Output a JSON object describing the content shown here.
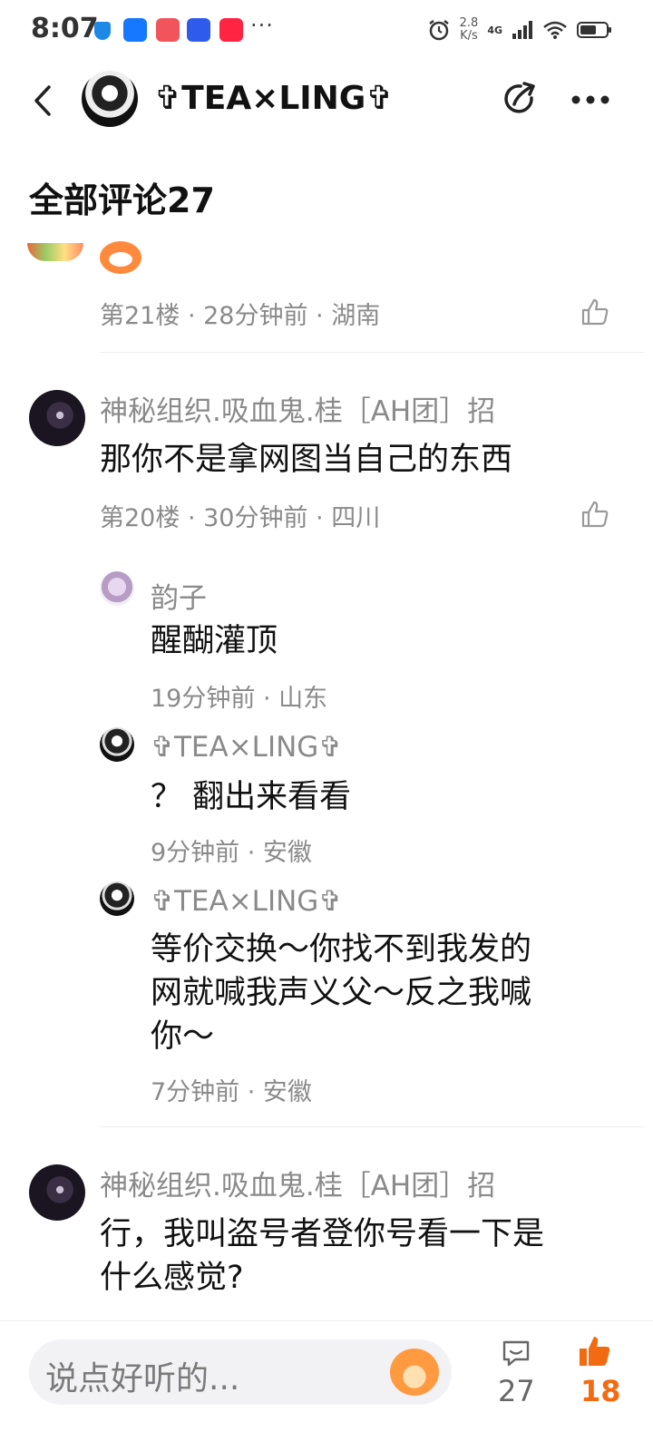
{
  "status_bar": {
    "time": "8:07",
    "more_apps": "···",
    "net_speed_value": "2.8",
    "net_speed_unit": "K/s",
    "network": "4G"
  },
  "header": {
    "title": "✞TEA×LING✞"
  },
  "section": {
    "title": "全部评论27"
  },
  "comments": [
    {
      "meta": "第21楼 · 28分钟前 · 湖南"
    },
    {
      "author": "神秘组织.吸血鬼.桂［AH团］招",
      "text": "那你不是拿网图当自己的东西",
      "meta": "第20楼 · 30分钟前 · 四川",
      "replies": [
        {
          "author": "韵子",
          "text": "醒醐灌顶",
          "meta": "19分钟前 · 山东"
        },
        {
          "author": "✞TEA×LING✞",
          "text": "？ 翻出来看看",
          "meta": "9分钟前 · 安徽"
        },
        {
          "author": "✞TEA×LING✞",
          "text_line1": "等价交换～你找不到我发的",
          "text_line2": "网就喊我声义父～反之我喊",
          "text_line3": "你～",
          "meta": "7分钟前 · 安徽"
        }
      ]
    },
    {
      "author": "神秘组织.吸血鬼.桂［AH团］招",
      "text_line1": "行，我叫盗号者登你号看一下是",
      "text_line2": "什么感觉?"
    }
  ],
  "bottom_bar": {
    "input_placeholder": "说点好听的...",
    "comment_count": "27",
    "like_count": "18"
  },
  "colors": {
    "accent_orange": "#f26b10",
    "meta_gray": "#8a8a8a",
    "divider": "#ececec"
  }
}
